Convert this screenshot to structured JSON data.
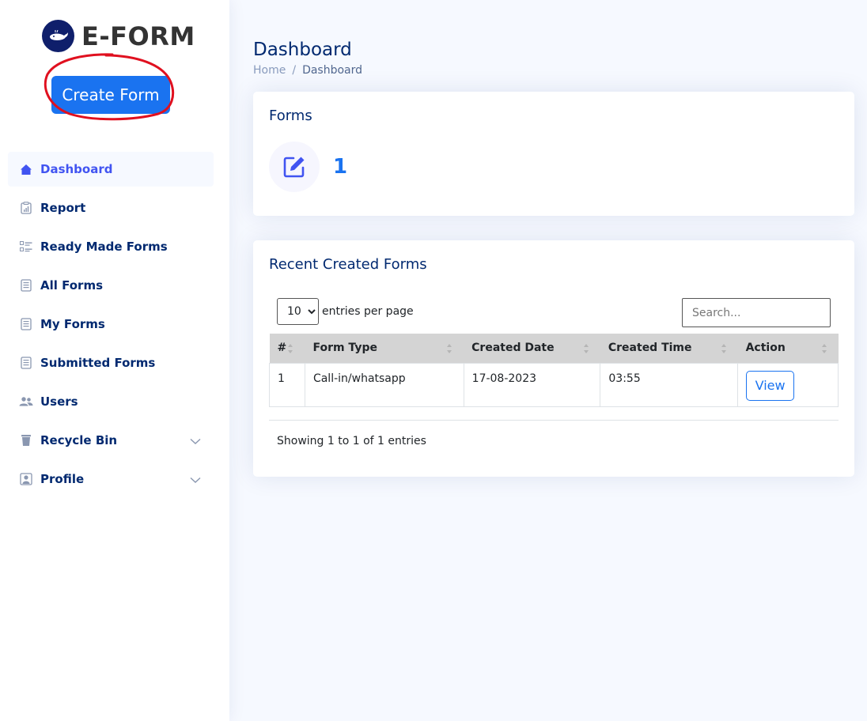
{
  "brand": {
    "name": "E-FORM"
  },
  "sidebar": {
    "create_button": "Create Form",
    "items": [
      {
        "label": "Dashboard",
        "icon": "house-icon",
        "active": true
      },
      {
        "label": "Report",
        "icon": "report-icon"
      },
      {
        "label": "Ready Made Forms",
        "icon": "list-icon"
      },
      {
        "label": "All Forms",
        "icon": "document-icon"
      },
      {
        "label": "My Forms",
        "icon": "document-icon"
      },
      {
        "label": "Submitted Forms",
        "icon": "document-icon"
      },
      {
        "label": "Users",
        "icon": "users-icon"
      },
      {
        "label": "Recycle Bin",
        "icon": "trash-icon",
        "expandable": true
      },
      {
        "label": "Profile",
        "icon": "person-icon",
        "expandable": true
      }
    ]
  },
  "header": {
    "title": "Dashboard",
    "breadcrumb": {
      "home": "Home",
      "separator": "/",
      "current": "Dashboard"
    }
  },
  "forms_card": {
    "title": "Forms",
    "count": "1",
    "icon": "edit-icon"
  },
  "recent": {
    "title": "Recent Created Forms",
    "entries_select": "10",
    "entries_label": "entries per page",
    "search_placeholder": "Search...",
    "columns": [
      "#",
      "Form Type",
      "Created Date",
      "Created Time",
      "Action"
    ],
    "rows": [
      {
        "num": "1",
        "type": "Call-in/whatsapp",
        "date": "17-08-2023",
        "time": "03:55",
        "action": "View"
      }
    ],
    "footer": "Showing 1 to 1 of 1 entries"
  },
  "colors": {
    "accent": "#1a73f0",
    "nav_active": "#4154f1",
    "text": "#012970",
    "annotation": "#e0101f"
  }
}
